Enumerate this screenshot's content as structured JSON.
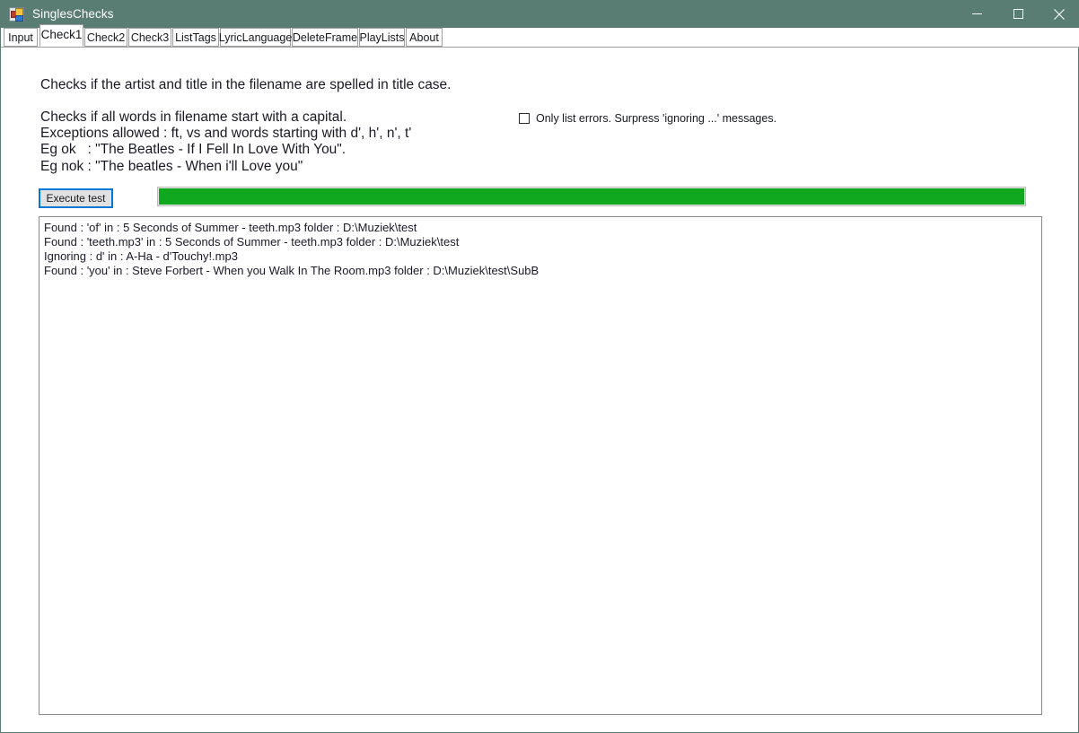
{
  "window": {
    "title": "SinglesChecks",
    "icon": "app-form-icon",
    "controls": {
      "minimize": "minimize-icon",
      "maximize": "maximize-icon",
      "close": "close-icon"
    },
    "titlebar_color": "#597d73"
  },
  "tabs": [
    {
      "label": "Input",
      "selected": false
    },
    {
      "label": "Check1",
      "selected": true
    },
    {
      "label": "Check2",
      "selected": false
    },
    {
      "label": "Check3",
      "selected": false
    },
    {
      "label": "ListTags",
      "selected": false
    },
    {
      "label": "LyricLanguage",
      "selected": false
    },
    {
      "label": "DeleteFrame",
      "selected": false
    },
    {
      "label": "PlayLists",
      "selected": false
    },
    {
      "label": "About",
      "selected": false
    }
  ],
  "description": {
    "line1": "Checks if the artist and title in the filename are spelled in title case.",
    "rest": "Checks if all words in filename start with a capital.\nExceptions allowed : ft, vs and words starting with d', h', n', t'\nEg ok   : \"The Beatles - If I Fell In Love With You\".\nEg nok : \"The beatles - When i'll Love you\""
  },
  "options": {
    "only_list_errors": {
      "label": "Only list errors. Surpress 'ignoring ...' messages.",
      "checked": false
    }
  },
  "actions": {
    "execute_label": "Execute test"
  },
  "progress": {
    "percent": 100,
    "fill_color": "#0fa81e"
  },
  "results": [
    "Found : 'of' in : 5 Seconds of Summer - teeth.mp3 folder : D:\\Muziek\\test",
    "Found : 'teeth.mp3' in : 5 Seconds of Summer - teeth.mp3 folder : D:\\Muziek\\test",
    "Ignoring : d' in : A-Ha - d'Touchy!.mp3",
    "Found : 'you' in : Steve Forbert - When you Walk In The Room.mp3 folder : D:\\Muziek\\test\\SubB"
  ]
}
